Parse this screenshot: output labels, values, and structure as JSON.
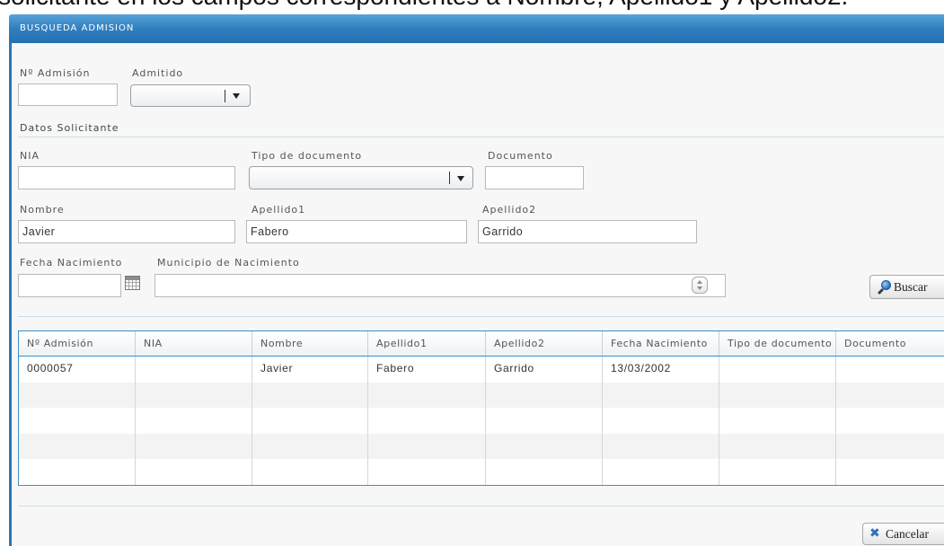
{
  "top_text": "solicitante en los campos correspondientes a Nombre, Apellido1 y Apellido2.",
  "window": {
    "title": "BUSQUEDA ADMISION"
  },
  "form": {
    "num_admision": {
      "label": "Nº Admisión",
      "value": ""
    },
    "admitido": {
      "label": "Admitido",
      "value": ""
    },
    "section_title": "Datos Solicitante",
    "nia": {
      "label": "NIA",
      "value": ""
    },
    "tipo_documento": {
      "label": "Tipo de documento",
      "value": ""
    },
    "documento": {
      "label": "Documento",
      "value": ""
    },
    "nombre": {
      "label": "Nombre",
      "value": "Javier"
    },
    "apellido1": {
      "label": "Apellido1",
      "value": "Fabero"
    },
    "apellido2": {
      "label": "Apellido2",
      "value": "Garrido"
    },
    "fecha_nacimiento": {
      "label": "Fecha Nacimiento",
      "value": ""
    },
    "municipio_nacimiento": {
      "label": "Municipio de Nacimiento",
      "value": ""
    }
  },
  "buttons": {
    "buscar": "Buscar",
    "cancelar": "Cancelar"
  },
  "icons": {
    "dropdown": "chevron-down-icon",
    "calendar": "calendar-icon",
    "spinner": "spinner-icon",
    "search": "search-icon",
    "cancel": "close-icon"
  },
  "results": {
    "columns": [
      "Nº Admisión",
      "NIA",
      "Nombre",
      "Apellido1",
      "Apellido2",
      "Fecha Nacimiento",
      "Tipo de documento",
      "Documento"
    ],
    "rows": [
      [
        "0000057",
        "",
        "Javier",
        "Fabero",
        "Garrido",
        "13/03/2002",
        "",
        ""
      ]
    ]
  },
  "colors": {
    "title_bar": "#307ebe",
    "window_border": "#2a76b4",
    "grid_border": "#3d8fc8",
    "icon_blue": "#2f6fc1"
  }
}
